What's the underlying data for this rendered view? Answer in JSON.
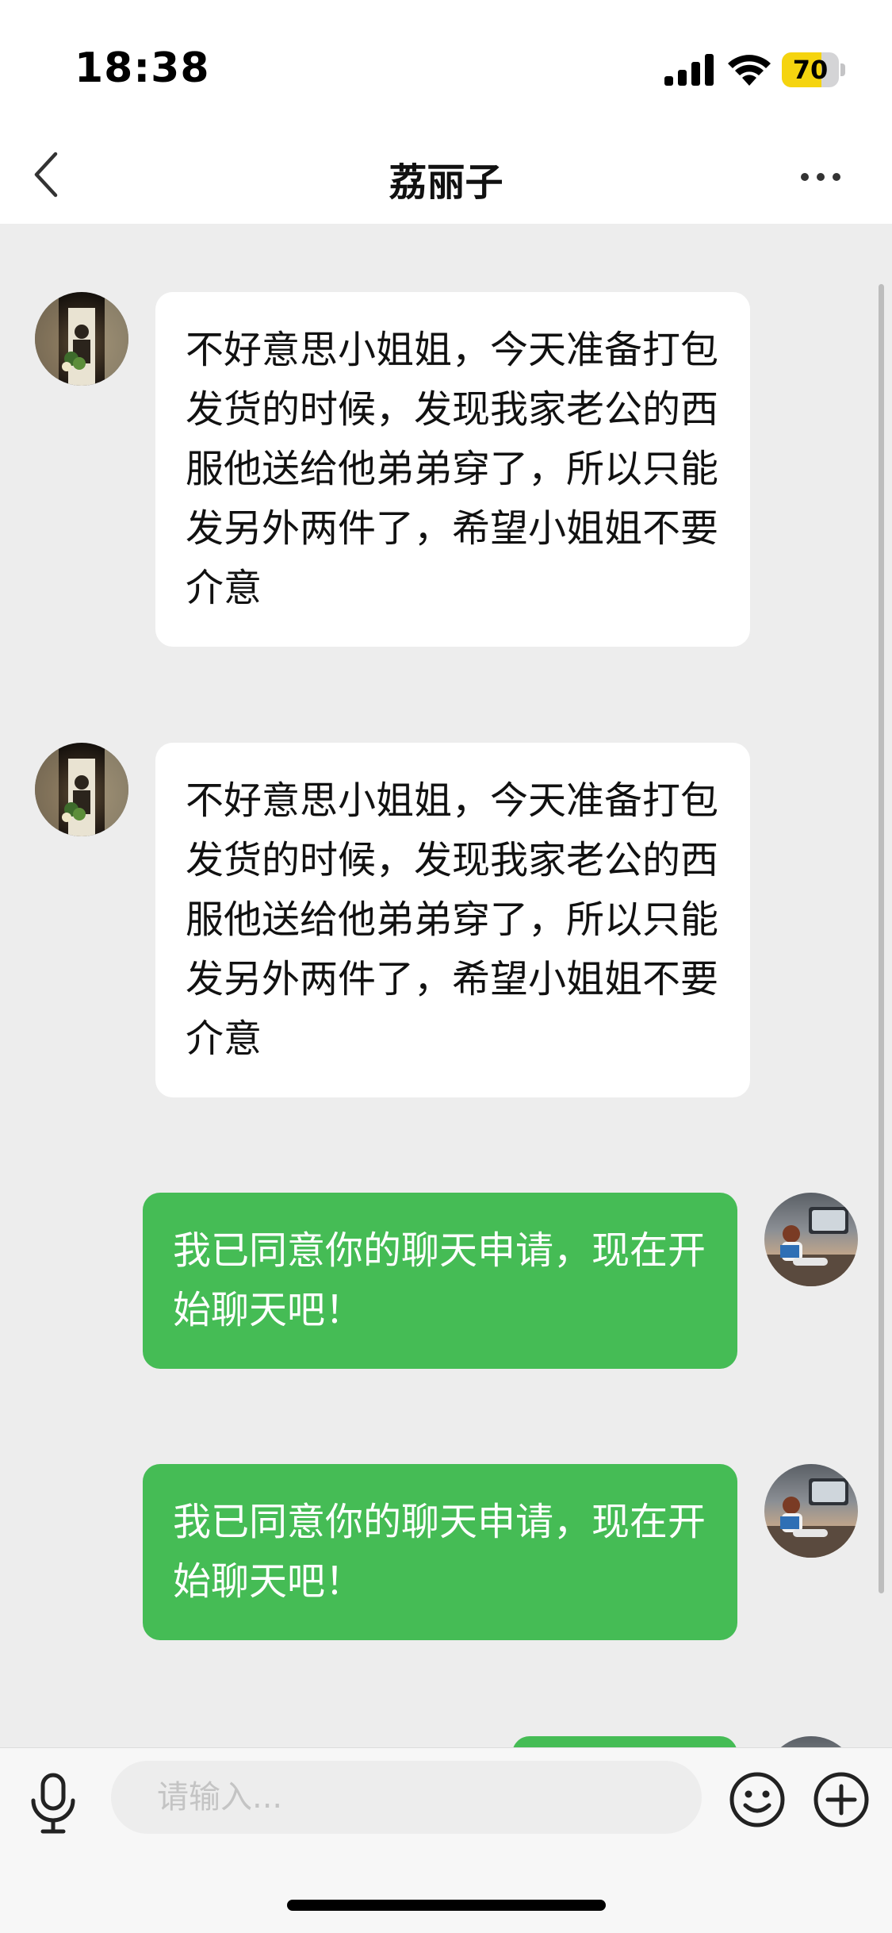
{
  "status_bar": {
    "time": "18:38",
    "battery_level": "70",
    "battery_fraction": 0.7,
    "icons": [
      "cellular-signal-icon",
      "wifi-icon",
      "battery-charging-icon"
    ]
  },
  "nav": {
    "title": "荔丽子",
    "back_icon": "chevron-left-icon",
    "more_icon": "more-dots-icon"
  },
  "messages": [
    {
      "sender": "friend",
      "text": "不好意思小姐姐，今天准备打包发货的时候，发现我家老公的西服他送给他弟弟穿了，所以只能发另外两件了，希望小姐姐不要介意"
    },
    {
      "sender": "friend",
      "text": "不好意思小姐姐，今天准备打包发货的时候，发现我家老公的西服他送给他弟弟穿了，所以只能发另外两件了，希望小姐姐不要介意"
    },
    {
      "sender": "self",
      "text": "我已同意你的聊天申请，现在开始聊天吧！"
    },
    {
      "sender": "self",
      "text": "我已同意你的聊天申请，现在开始聊天吧！"
    },
    {
      "sender": "self",
      "text": ""
    }
  ],
  "input": {
    "placeholder": "请输入...",
    "value": ""
  },
  "colors": {
    "outgoing_bubble": "#45bc55",
    "incoming_bubble": "#ffffff",
    "chat_background": "#ededed",
    "battery": "#f5d40f"
  }
}
